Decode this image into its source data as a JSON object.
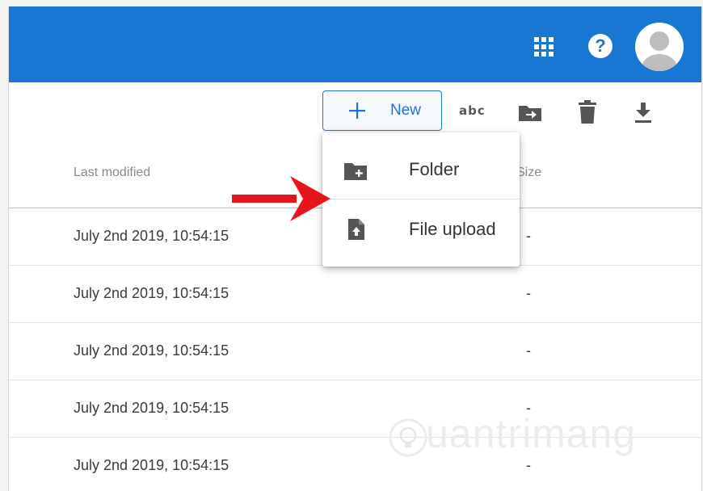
{
  "header": {
    "apps_icon": "apps-grid-icon",
    "help_icon": "help-icon",
    "help_glyph": "?",
    "avatar_icon": "account-avatar-icon",
    "bar_color": "#1976d2"
  },
  "toolbar": {
    "new_label": "New",
    "new_icon": "plus-icon",
    "rename_label": "abc",
    "move_icon": "move-folder-icon",
    "delete_icon": "trash-icon",
    "download_icon": "download-icon"
  },
  "table": {
    "columns": [
      "Last modified",
      "Size"
    ],
    "rows": [
      {
        "modified": "July 2nd 2019, 10:54:15",
        "size": "-"
      },
      {
        "modified": "July 2nd 2019, 10:54:15",
        "size": "-"
      },
      {
        "modified": "July 2nd 2019, 10:54:15",
        "size": "-"
      },
      {
        "modified": "July 2nd 2019, 10:54:15",
        "size": "-"
      },
      {
        "modified": "July 2nd 2019, 10:54:15",
        "size": "-"
      }
    ]
  },
  "new_menu": {
    "items": [
      {
        "label": "Folder",
        "icon": "folder-add-icon"
      },
      {
        "label": "File upload",
        "icon": "file-upload-icon"
      }
    ]
  },
  "annotation": {
    "arrow_color": "#e8141b"
  },
  "watermark": {
    "text": "uantrimang"
  }
}
